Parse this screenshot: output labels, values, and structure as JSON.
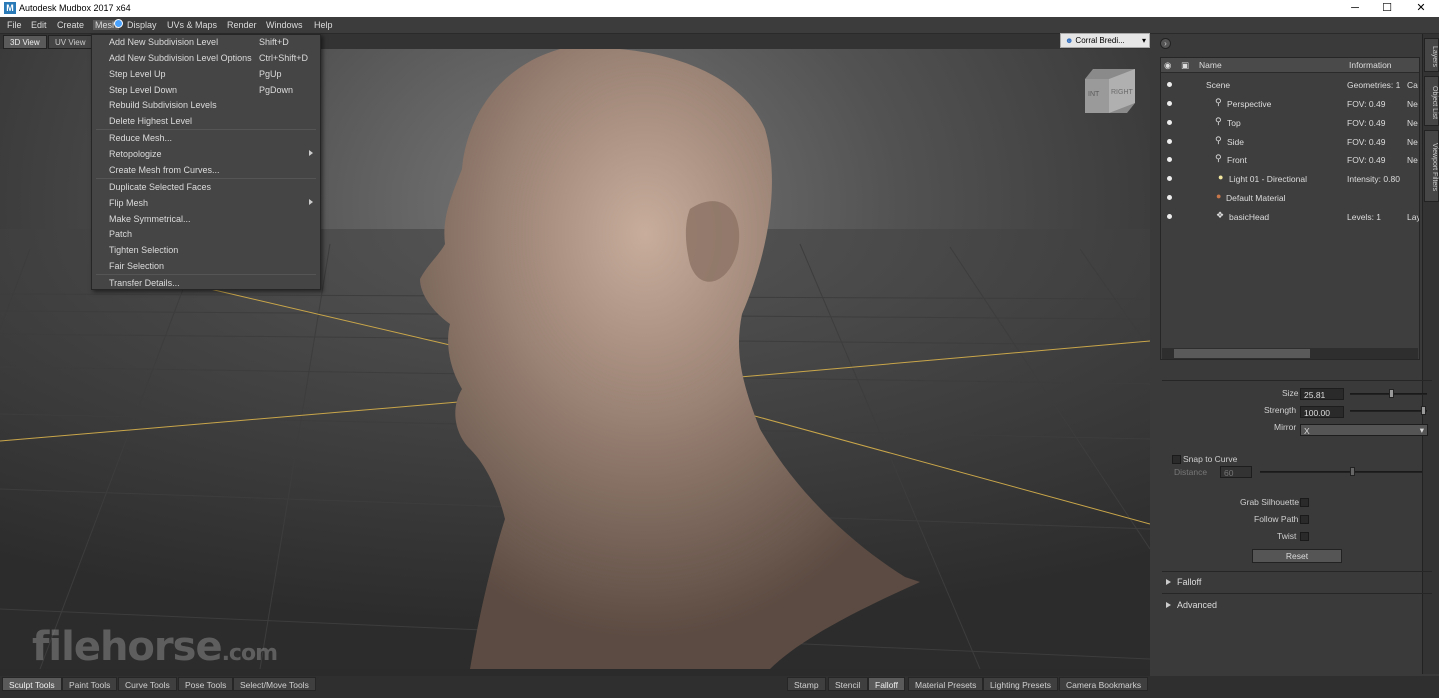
{
  "app": {
    "title": "Autodesk Mudbox 2017 x64"
  },
  "window_controls": {
    "minimize": "─",
    "maximize": "☐",
    "close": "✕"
  },
  "menubar": [
    "File",
    "Edit",
    "Create",
    "Mesh",
    "Display",
    "UVs & Maps",
    "Render",
    "Windows",
    "Help"
  ],
  "view_tabs": [
    "3D View",
    "UV View"
  ],
  "camera_selector": "Corral Bredi...",
  "viewcube": {
    "left_face": "INT",
    "right_face": "RIGHT"
  },
  "mesh_menu": {
    "groups": [
      [
        {
          "label": "Add New Subdivision Level",
          "shortcut": "Shift+D"
        },
        {
          "label": "Add New Subdivision Level Options",
          "shortcut": "Ctrl+Shift+D"
        },
        {
          "label": "Step Level Up",
          "shortcut": "PgUp"
        },
        {
          "label": "Step Level Down",
          "shortcut": "PgDown"
        },
        {
          "label": "Rebuild Subdivision Levels",
          "shortcut": ""
        },
        {
          "label": "Delete Highest Level",
          "shortcut": ""
        }
      ],
      [
        {
          "label": "Reduce Mesh...",
          "shortcut": ""
        },
        {
          "label": "Retopologize",
          "shortcut": "",
          "submenu": true
        },
        {
          "label": "Create Mesh from Curves...",
          "shortcut": ""
        }
      ],
      [
        {
          "label": "Duplicate Selected Faces",
          "shortcut": ""
        },
        {
          "label": "Flip Mesh",
          "shortcut": "",
          "submenu": true
        },
        {
          "label": "Make Symmetrical...",
          "shortcut": ""
        },
        {
          "label": "Patch",
          "shortcut": ""
        },
        {
          "label": "Tighten Selection",
          "shortcut": ""
        },
        {
          "label": "Fair Selection",
          "shortcut": ""
        }
      ],
      [
        {
          "label": "Transfer Details...",
          "shortcut": ""
        }
      ]
    ]
  },
  "outliner": {
    "headers": {
      "name": "Name",
      "info": "Information"
    },
    "rows": [
      {
        "name": "Scene",
        "info": "Geometries: 1",
        "info2": "Ca"
      },
      {
        "name": "Perspective",
        "info": "FOV: 0.49",
        "info2": "Ne"
      },
      {
        "name": "Top",
        "info": "FOV: 0.49",
        "info2": "Ne"
      },
      {
        "name": "Side",
        "info": "FOV: 0.49",
        "info2": "Ne"
      },
      {
        "name": "Front",
        "info": "FOV: 0.49",
        "info2": "Ne"
      },
      {
        "name": "Light 01 - Directional",
        "info": "Intensity: 0.80",
        "info2": ""
      },
      {
        "name": "Default Material",
        "info": "",
        "info2": ""
      },
      {
        "name": "basicHead",
        "info": "Levels: 1",
        "info2": "Lay"
      }
    ]
  },
  "side_tabs": [
    "Layers",
    "Object List",
    "Viewport Filters"
  ],
  "properties": {
    "size_label": "Size",
    "size_value": "25.81",
    "size_level": 0.55,
    "strength_label": "Strength",
    "strength_value": "100.00",
    "strength_level": 1.0,
    "mirror_label": "Mirror",
    "mirror_value": "X",
    "snap_label": "Snap to Curve",
    "distance_label": "Distance",
    "distance_value": "60",
    "distance_level": 0.58,
    "grab_label": "Grab Silhouette",
    "follow_label": "Follow Path",
    "twist_label": "Twist",
    "reset_label": "Reset",
    "falloff_label": "Falloff",
    "advanced_label": "Advanced"
  },
  "bottom_tabs_left": [
    "Sculpt Tools",
    "Paint Tools",
    "Curve Tools",
    "Pose Tools",
    "Select/Move Tools"
  ],
  "bottom_tabs_right": [
    "Stamp",
    "Stencil",
    "Falloff",
    "Material Presets",
    "Lighting Presets",
    "Camera Bookmarks"
  ],
  "watermark": {
    "main": "filehorse",
    "suffix": ".com"
  }
}
